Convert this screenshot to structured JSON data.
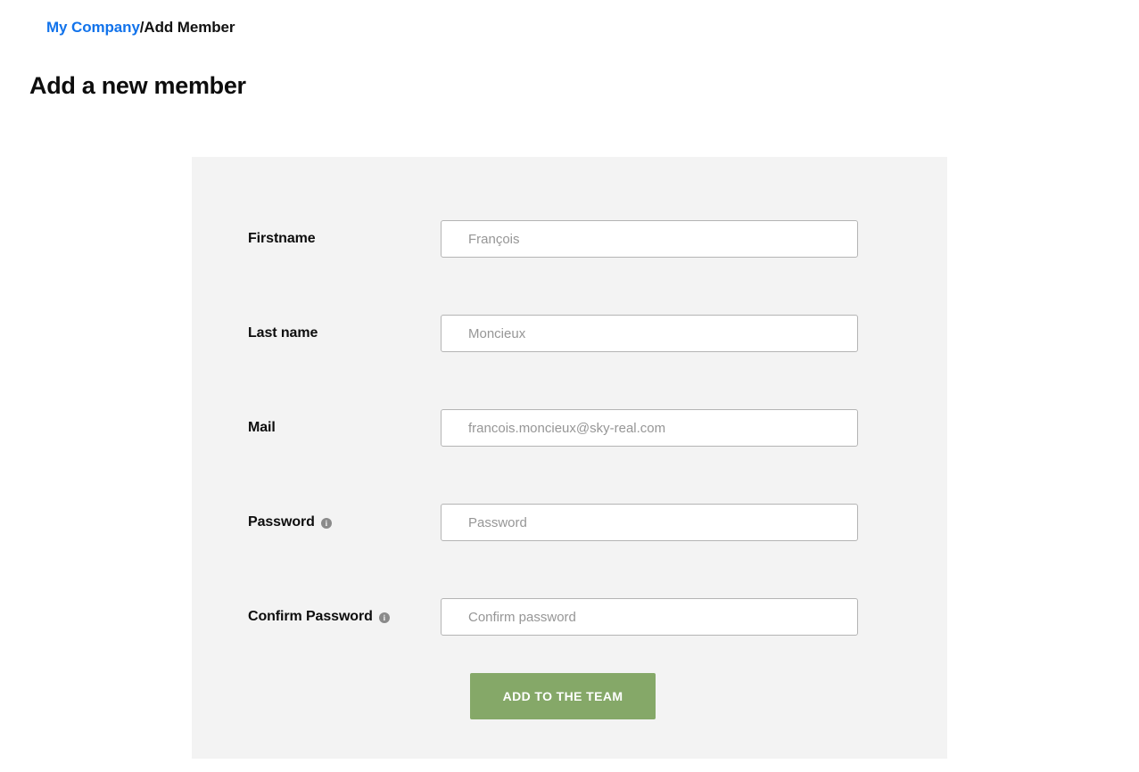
{
  "breadcrumb": {
    "link_label": "My Company",
    "separator": "/",
    "current_label": "Add Member"
  },
  "page": {
    "title": "Add a new member"
  },
  "form": {
    "fields": [
      {
        "label": "Firstname",
        "placeholder": "François",
        "has_info_icon": false,
        "value": ""
      },
      {
        "label": "Last name",
        "placeholder": "Moncieux",
        "has_info_icon": false,
        "value": ""
      },
      {
        "label": "Mail",
        "placeholder": "francois.moncieux@sky-real.com",
        "has_info_icon": false,
        "value": ""
      },
      {
        "label": "Password",
        "placeholder": "Password",
        "has_info_icon": true,
        "info_icon_glyph": "i",
        "value": ""
      },
      {
        "label": "Confirm Password",
        "placeholder": "Confirm password",
        "has_info_icon": true,
        "info_icon_glyph": "i",
        "value": ""
      }
    ],
    "submit_label": "ADD TO THE TEAM"
  },
  "colors": {
    "link_blue": "#1273eb",
    "card_background": "#f3f3f3",
    "page_background": "#ffffff",
    "submit_green": "#85a868",
    "input_border": "#b4b4b4",
    "placeholder_text": "#969696",
    "info_icon_gray": "#8a8a8a"
  }
}
